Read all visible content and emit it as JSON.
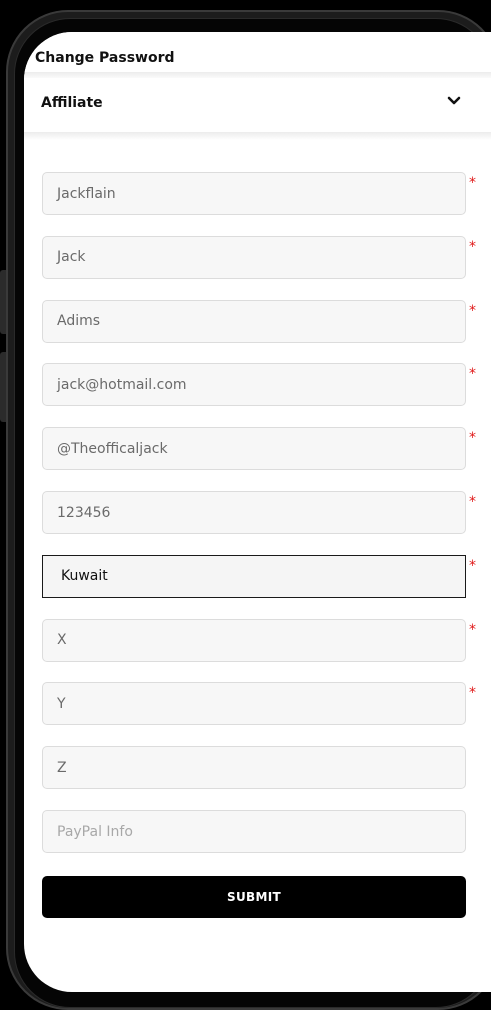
{
  "menu": {
    "change_password_label": "Change Password",
    "affiliate_label": "Affiliate",
    "affiliate_icon": "chevron-down-icon"
  },
  "form": {
    "fields": [
      {
        "name": "username-field",
        "value": "Jackflain",
        "required": true
      },
      {
        "name": "first-name-field",
        "value": "Jack",
        "required": true
      },
      {
        "name": "last-name-field",
        "value": "Adims",
        "required": true
      },
      {
        "name": "email-field",
        "value": "jack@hotmail.com",
        "required": true
      },
      {
        "name": "social-handle-field",
        "value": "@Theofficaljack",
        "required": true
      },
      {
        "name": "phone-field",
        "value": "123456",
        "required": true
      },
      {
        "name": "country-select",
        "value": "Kuwait",
        "required": true
      },
      {
        "name": "x-field",
        "value": "X",
        "required": true
      },
      {
        "name": "y-field",
        "value": "Y",
        "required": true
      },
      {
        "name": "z-field",
        "value": "Z",
        "required": false
      },
      {
        "name": "paypal-info-field",
        "placeholder": "PayPal Info",
        "required": false
      }
    ],
    "required_marker": "*",
    "submit_label": "SUBMIT"
  },
  "colors": {
    "required": "#e01919",
    "button_bg": "#000000",
    "field_bg": "#f7f7f7"
  }
}
